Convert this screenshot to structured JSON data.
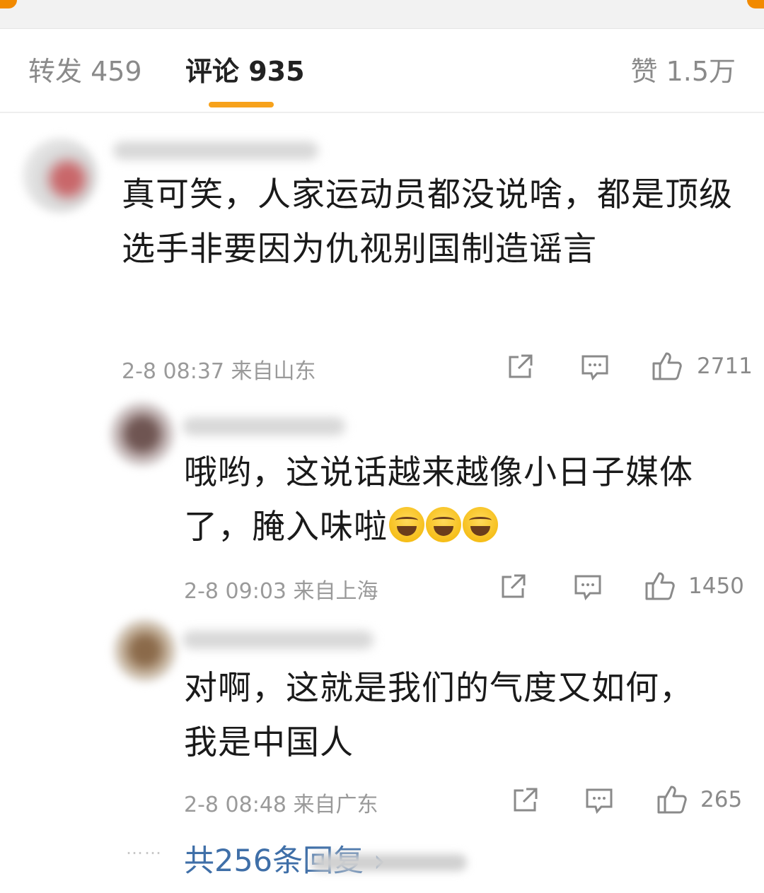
{
  "tabs": {
    "repost": "转发 459",
    "comments": "评论 935",
    "likes": "赞 1.5万"
  },
  "comments": [
    {
      "text": "真可笑，人家运动员都没说啥，都是顶级选手非要因为仇视别国制造谣言",
      "time": "2-8 08:37",
      "location": "来自山东",
      "likes": "2711"
    },
    {
      "text": "哦哟，这说话越来越像小日子媒体了，腌入味啦",
      "emoji": "laughing-tears",
      "time": "2-8 09:03",
      "location": "来自上海",
      "likes": "1450"
    },
    {
      "text": "对啊，这就是我们的气度又如何，我是中国人",
      "time": "2-8 08:48",
      "location": "来自广东",
      "likes": "265"
    }
  ],
  "replies_link": "共256条回复 ›",
  "colors": {
    "accent": "#f7a21b",
    "link": "#3f6fa8",
    "muted": "#9a9a9a"
  }
}
